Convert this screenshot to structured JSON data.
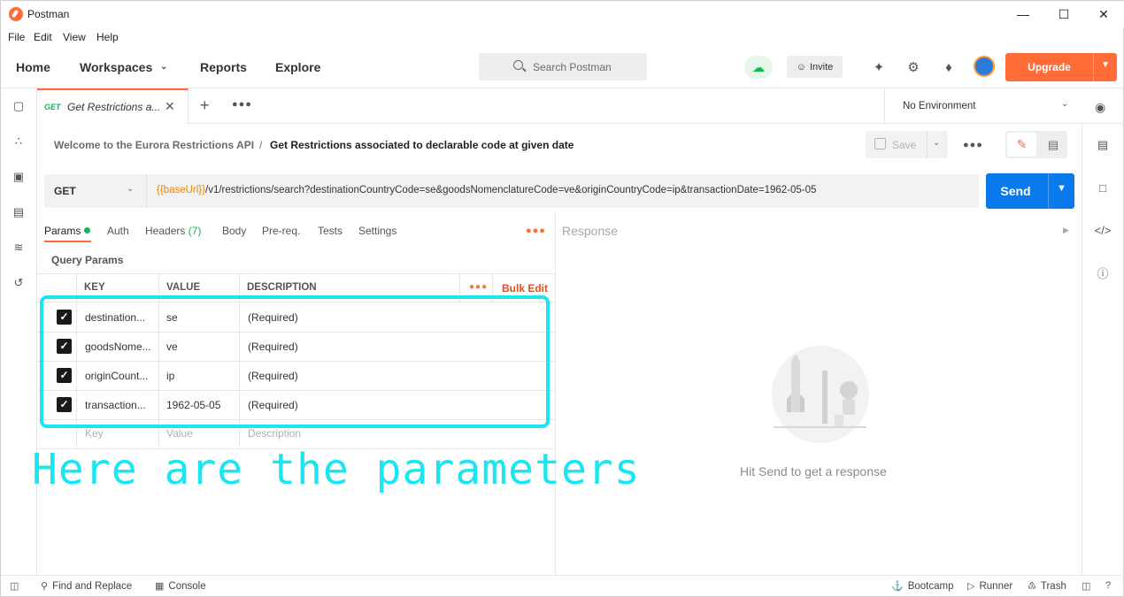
{
  "window": {
    "title": "Postman"
  },
  "menu": [
    "File",
    "Edit",
    "View",
    "Help"
  ],
  "nav": {
    "home": "Home",
    "workspaces": "Workspaces",
    "reports": "Reports",
    "explore": "Explore",
    "search_placeholder": "Search Postman",
    "invite": "Invite",
    "upgrade": "Upgrade"
  },
  "tab": {
    "method": "GET",
    "title": "Get Restrictions a..."
  },
  "environment": "No Environment",
  "breadcrumb": {
    "parent": "Welcome to the Eurora Restrictions API",
    "separator": "/",
    "current": "Get Restrictions associated to declarable code at given date"
  },
  "save_label": "Save",
  "request": {
    "method": "GET",
    "url_variable": "{{baseUrl}}",
    "url_rest": "/v1/restrictions/search?destinationCountryCode=se&goodsNomenclatureCode=ve&originCountryCode=ip&transactionDate=1962-05-05",
    "send": "Send"
  },
  "request_tabs": {
    "params": "Params",
    "auth": "Auth",
    "headers": "Headers",
    "headers_count": "(7)",
    "body": "Body",
    "prereq": "Pre-req.",
    "tests": "Tests",
    "settings": "Settings"
  },
  "query_params": {
    "title": "Query Params",
    "columns": {
      "key": "KEY",
      "value": "VALUE",
      "description": "DESCRIPTION"
    },
    "bulk_edit": "Bulk Edit",
    "rows": [
      {
        "key": "destination...",
        "value": "se",
        "description": "(Required)",
        "checked": true
      },
      {
        "key": "goodsNome...",
        "value": "ve",
        "description": "(Required)",
        "checked": true
      },
      {
        "key": "originCount...",
        "value": "ip",
        "description": "(Required)",
        "checked": true
      },
      {
        "key": "transaction...",
        "value": "1962-05-05",
        "description": "(Required)",
        "checked": true
      }
    ],
    "placeholder": {
      "key": "Key",
      "value": "Value",
      "description": "Description"
    }
  },
  "annotation": "Here are the parameters",
  "annotation_color": "#19e6f0",
  "response": {
    "title": "Response",
    "hint": "Hit Send to get a response"
  },
  "statusbar": {
    "find_replace": "Find and Replace",
    "console": "Console",
    "bootcamp": "Bootcamp",
    "runner": "Runner",
    "trash": "Trash"
  },
  "colors": {
    "accent": "#ff6c37",
    "send": "#097bed",
    "get": "#0cbb52"
  }
}
